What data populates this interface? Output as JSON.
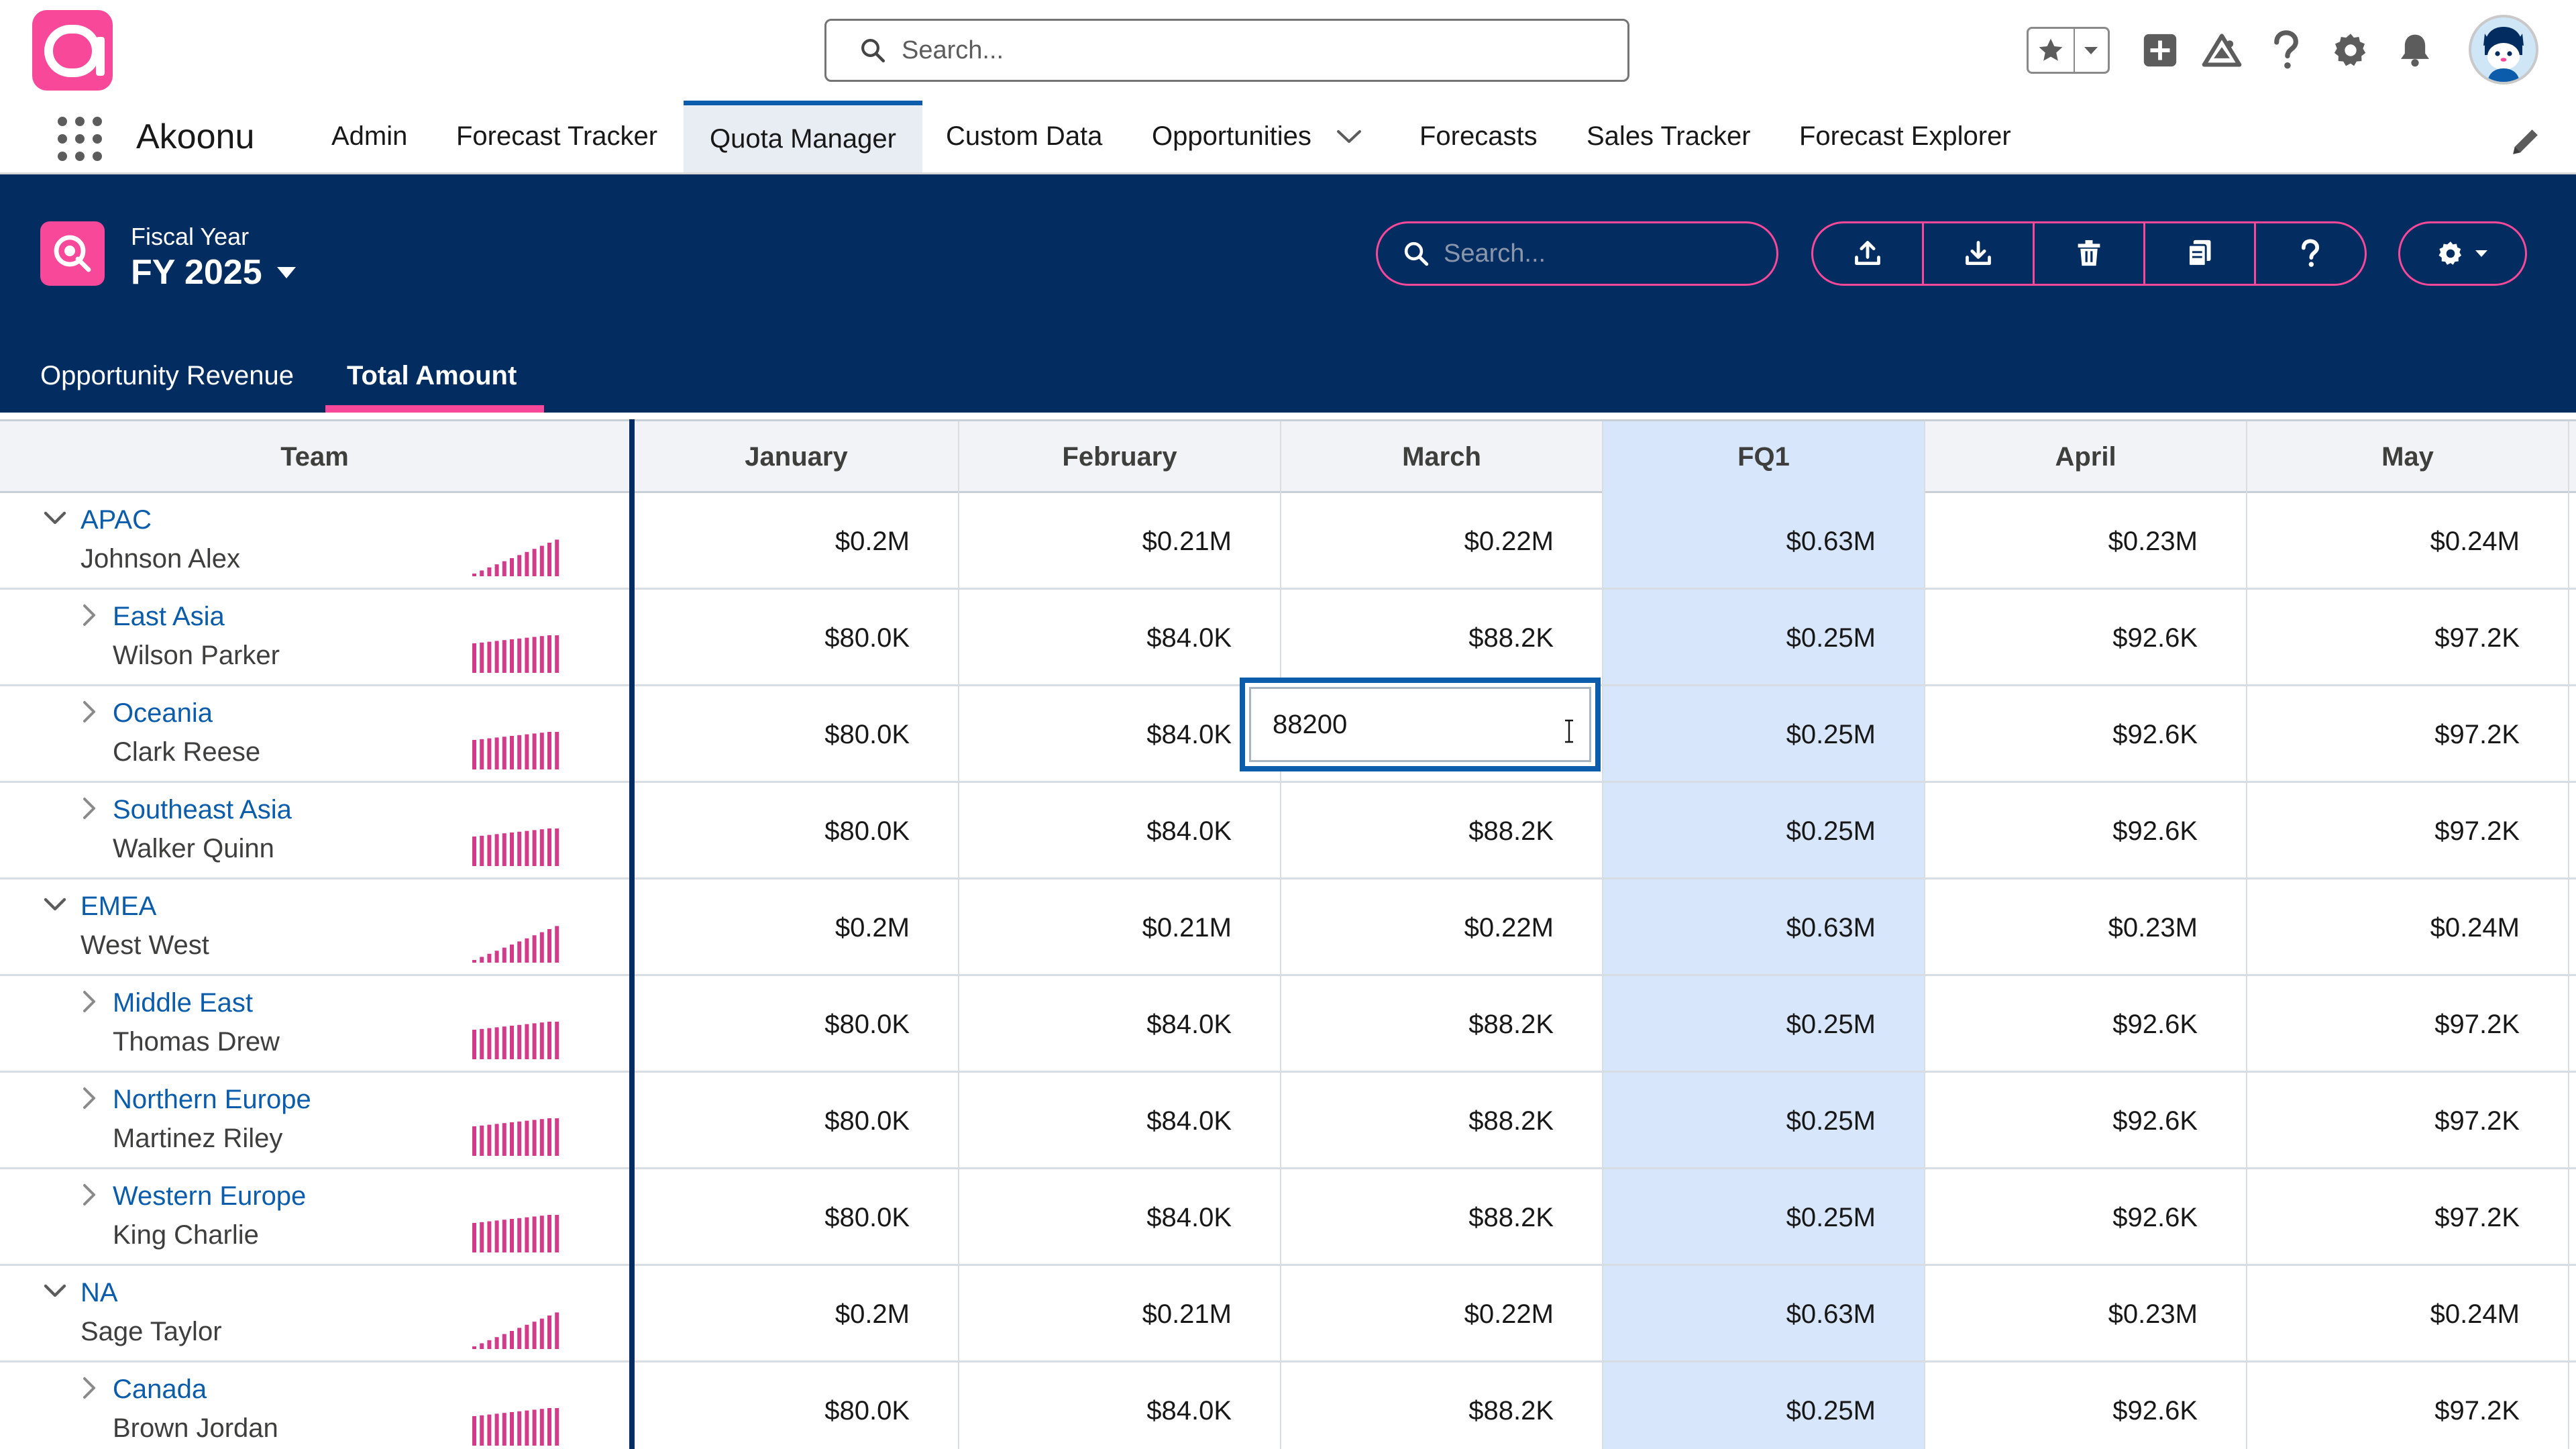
{
  "global_header": {
    "search_placeholder": "Search...",
    "icons": [
      "favorites-star-icon",
      "favorites-dropdown-icon",
      "global-add-icon",
      "trailhead-icon",
      "help-icon",
      "setup-gear-icon",
      "notifications-bell-icon"
    ]
  },
  "nav": {
    "app_name": "Akoonu",
    "items": [
      {
        "label": "Admin"
      },
      {
        "label": "Forecast Tracker"
      },
      {
        "label": "Quota Manager"
      },
      {
        "label": "Custom Data"
      },
      {
        "label": "Opportunities"
      },
      {
        "label": "Forecasts"
      },
      {
        "label": "Sales Tracker"
      },
      {
        "label": "Forecast Explorer"
      }
    ],
    "active": "Quota Manager"
  },
  "panel": {
    "fiscal_year_label": "Fiscal Year",
    "fiscal_year_value": "FY 2025",
    "search_placeholder": "Search...",
    "toolbar": [
      "upload-icon",
      "download-icon",
      "delete-icon",
      "copy-icon",
      "help-icon"
    ],
    "tabs": [
      {
        "label": "Opportunity Revenue"
      },
      {
        "label": "Total Amount"
      }
    ],
    "active_tab": "Total Amount"
  },
  "colors": {
    "brand_pink": "#f7489a",
    "panel_navy": "#032d60",
    "link_blue": "#0b5cab",
    "quarter_highlight": "#d8e6fb"
  },
  "grid": {
    "columns": [
      "Team",
      "January",
      "February",
      "March",
      "FQ1",
      "April",
      "May"
    ],
    "rows": [
      {
        "team": "APAC",
        "owner": "Johnson Alex",
        "level": 0,
        "expanded": true,
        "values": [
          "$0.2M",
          "$0.21M",
          "$0.22M",
          "$0.63M",
          "$0.23M",
          "$0.24M"
        ]
      },
      {
        "team": "East Asia",
        "owner": "Wilson Parker",
        "level": 1,
        "expanded": false,
        "values": [
          "$80.0K",
          "$84.0K",
          "$88.2K",
          "$0.25M",
          "$92.6K",
          "$97.2K"
        ]
      },
      {
        "team": "Oceania",
        "owner": "Clark Reese",
        "level": 1,
        "expanded": false,
        "values": [
          "$80.0K",
          "$84.0K",
          "",
          "$0.25M",
          "$92.6K",
          "$97.2K"
        ]
      },
      {
        "team": "Southeast Asia",
        "owner": "Walker Quinn",
        "level": 1,
        "expanded": false,
        "values": [
          "$80.0K",
          "$84.0K",
          "$88.2K",
          "$0.25M",
          "$92.6K",
          "$97.2K"
        ]
      },
      {
        "team": "EMEA",
        "owner": "West West",
        "level": 0,
        "expanded": true,
        "values": [
          "$0.2M",
          "$0.21M",
          "$0.22M",
          "$0.63M",
          "$0.23M",
          "$0.24M"
        ]
      },
      {
        "team": "Middle East",
        "owner": "Thomas Drew",
        "level": 1,
        "expanded": false,
        "values": [
          "$80.0K",
          "$84.0K",
          "$88.2K",
          "$0.25M",
          "$92.6K",
          "$97.2K"
        ]
      },
      {
        "team": "Northern Europe",
        "owner": "Martinez Riley",
        "level": 1,
        "expanded": false,
        "values": [
          "$80.0K",
          "$84.0K",
          "$88.2K",
          "$0.25M",
          "$92.6K",
          "$97.2K"
        ]
      },
      {
        "team": "Western Europe",
        "owner": "King Charlie",
        "level": 1,
        "expanded": false,
        "values": [
          "$80.0K",
          "$84.0K",
          "$88.2K",
          "$0.25M",
          "$92.6K",
          "$97.2K"
        ]
      },
      {
        "team": "NA",
        "owner": "Sage Taylor",
        "level": 0,
        "expanded": true,
        "values": [
          "$0.2M",
          "$0.21M",
          "$0.22M",
          "$0.63M",
          "$0.23M",
          "$0.24M"
        ]
      },
      {
        "team": "Canada",
        "owner": "Brown Jordan",
        "level": 1,
        "expanded": false,
        "values": [
          "$80.0K",
          "$84.0K",
          "$88.2K",
          "$0.25M",
          "$92.6K",
          "$97.2K"
        ]
      }
    ],
    "editing_cell": {
      "team": "Oceania",
      "column": "March",
      "value": "88200"
    }
  }
}
